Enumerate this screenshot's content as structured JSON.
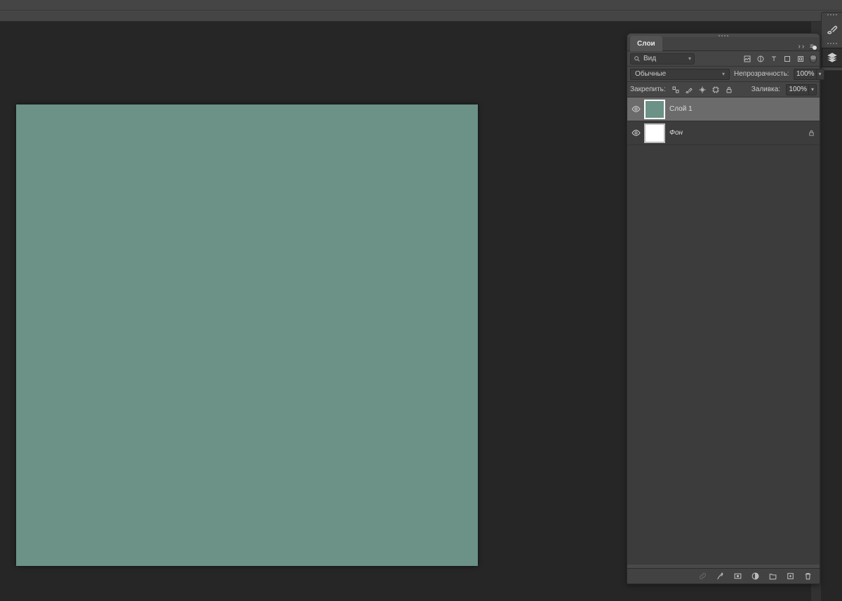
{
  "top": {
    "collapse_chevrons": "»"
  },
  "colors": {
    "canvas_fill": "#6c9187"
  },
  "icon_strip": {
    "brush_name": "brush-icon",
    "layers_name": "layers-icon"
  },
  "layers_panel": {
    "tab_label": "Слои",
    "search_placeholder": "Вид",
    "blend_mode": "Обычные",
    "opacity_label": "Непрозрачность:",
    "opacity_value": "100%",
    "lock_label": "Закрепить:",
    "fill_label": "Заливка:",
    "fill_value": "100%",
    "layers": [
      {
        "name": "Слой 1",
        "thumb_color": "#6c9187",
        "selected": true,
        "visible": true,
        "locked": false,
        "italic": false
      },
      {
        "name": "Фон",
        "thumb_color": "#ffffff",
        "selected": false,
        "visible": true,
        "locked": true,
        "italic": true
      }
    ]
  }
}
